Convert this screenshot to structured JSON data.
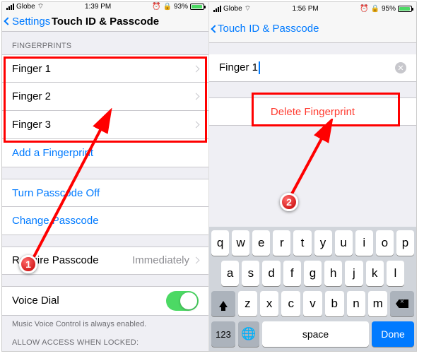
{
  "left": {
    "status": {
      "carrier": "Globe",
      "time": "1:39 PM",
      "battery": "93%"
    },
    "nav": {
      "back": "Settings",
      "title": "Touch ID & Passcode"
    },
    "fingerprints_header": "FINGERPRINTS",
    "fingers": [
      "Finger 1",
      "Finger 2",
      "Finger 3"
    ],
    "add": "Add a Fingerprint",
    "passcode_off": "Turn Passcode Off",
    "change_passcode": "Change Passcode",
    "require_label": "Require Passcode",
    "require_value": "Immediately",
    "voice_dial": "Voice Dial",
    "voice_note": "Music Voice Control is always enabled.",
    "allow_header": "ALLOW ACCESS WHEN LOCKED:"
  },
  "right": {
    "status": {
      "carrier": "Globe",
      "time": "1:56 PM",
      "battery": "95%"
    },
    "nav": {
      "back": "Touch ID & Passcode"
    },
    "finger_name": "Finger 1",
    "delete": "Delete Fingerprint",
    "keyboard": {
      "row1": [
        "q",
        "w",
        "e",
        "r",
        "t",
        "y",
        "u",
        "i",
        "o",
        "p"
      ],
      "row2": [
        "a",
        "s",
        "d",
        "f",
        "g",
        "h",
        "j",
        "k",
        "l"
      ],
      "row3": [
        "z",
        "x",
        "c",
        "v",
        "b",
        "n",
        "m"
      ],
      "num": "123",
      "space": "space",
      "done": "Done"
    }
  },
  "steps": {
    "one": "1",
    "two": "2"
  }
}
